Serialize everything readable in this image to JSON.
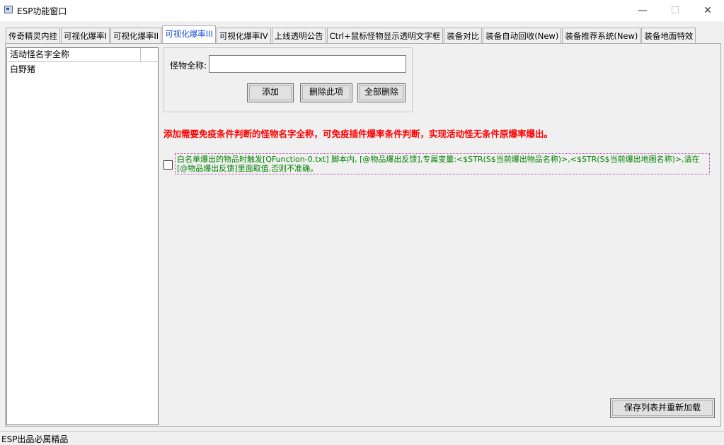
{
  "window": {
    "title": "ESP功能窗口",
    "controls": {
      "minimize": "—",
      "maximize": "☐",
      "close": "✕"
    }
  },
  "tabs": [
    {
      "label": "传奇精灵内挂",
      "active": false
    },
    {
      "label": "可视化爆率I",
      "active": false
    },
    {
      "label": "可视化爆率II",
      "active": false
    },
    {
      "label": "可视化爆率III",
      "active": true
    },
    {
      "label": "可视化爆率IV",
      "active": false
    },
    {
      "label": "上线透明公告",
      "active": false
    },
    {
      "label": "Ctrl+鼠标怪物显示透明文字框",
      "active": false
    },
    {
      "label": "装备对比",
      "active": false
    },
    {
      "label": "装备自动回收(New)",
      "active": false
    },
    {
      "label": "装备推荐系统(New)",
      "active": false
    },
    {
      "label": "装备地面特效",
      "active": false
    }
  ],
  "monster_list": {
    "column_header": "活动怪名字全称",
    "items": [
      "白野猪"
    ]
  },
  "form": {
    "name_label": "怪物全称:",
    "name_value": "",
    "add_label": "添加",
    "delete_label": "删除此项",
    "delete_all_label": "全部删除"
  },
  "notice": "添加需要免疫条件判断的怪物名字全称，可免疫插件爆率条件判断，实现活动怪无条件原爆率爆出。",
  "whitelist_option": {
    "checked": false,
    "text": "白名单爆出的物品时触发[QFunction-0.txt] 脚本内, [@物品爆出反馈],专属变量:<$STR(S$当前爆出物品名称)>,<$STR(S$当前爆出地图名称)>,请在[@物品爆出反馈]里面取值,否则不准确。"
  },
  "save_button_label": "保存列表并重新加载",
  "status_text": "ESP出品必属精品",
  "colors": {
    "accent_tab": "#1a4bd6",
    "notice": "#ff0000",
    "option_text": "#008000"
  }
}
